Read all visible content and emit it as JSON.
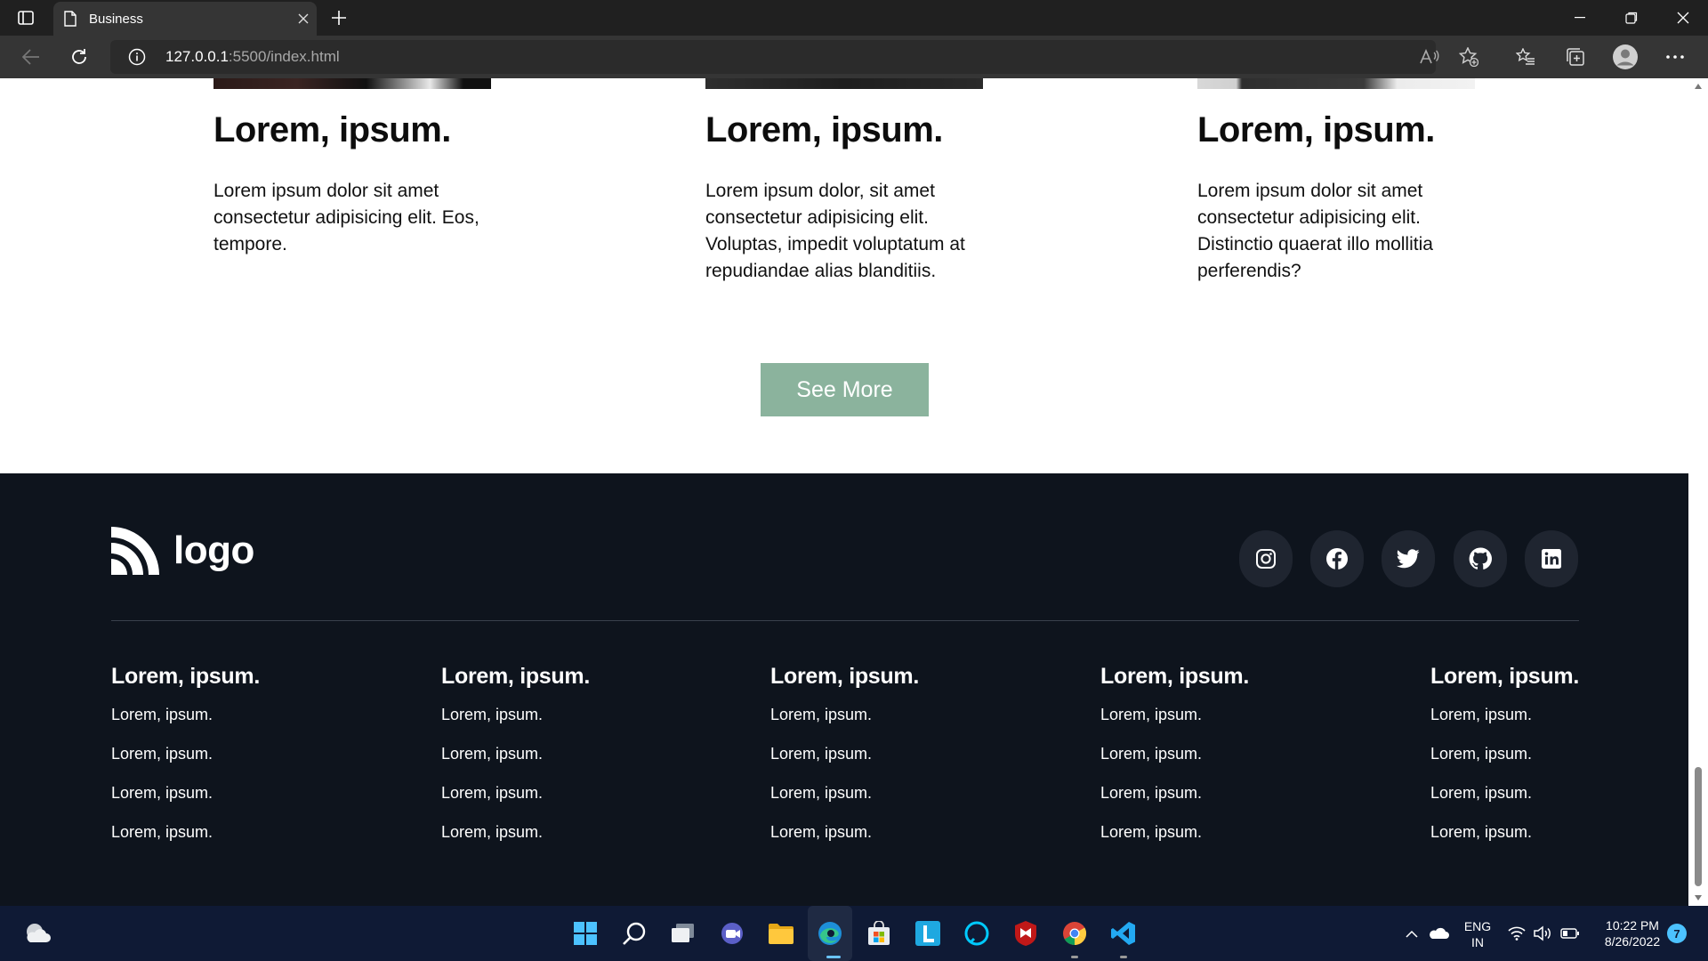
{
  "browser": {
    "tab_title": "Business",
    "url_host": "127.0.0.1",
    "url_rest": ":5500/index.html"
  },
  "cards": [
    {
      "title": "Lorem, ipsum.",
      "text": "Lorem ipsum dolor sit amet consectetur adipisicing elit. Eos, tempore."
    },
    {
      "title": "Lorem, ipsum.",
      "text": "Lorem ipsum dolor, sit amet consectetur adipisicing elit. Voluptas, impedit voluptatum at repudiandae alias blanditiis."
    },
    {
      "title": "Lorem, ipsum.",
      "text": "Lorem ipsum dolor sit amet consectetur adipisicing elit. Distinctio quaerat illo mollitia perferendis?"
    }
  ],
  "see_more_label": "See More",
  "footer": {
    "logo_text": "logo",
    "social_icons": [
      "instagram-icon",
      "facebook-icon",
      "twitter-icon",
      "github-icon",
      "linkedin-icon"
    ],
    "columns": [
      {
        "title": "Lorem, ipsum.",
        "links": [
          "Lorem, ipsum.",
          "Lorem, ipsum.",
          "Lorem, ipsum.",
          "Lorem, ipsum."
        ]
      },
      {
        "title": "Lorem, ipsum.",
        "links": [
          "Lorem, ipsum.",
          "Lorem, ipsum.",
          "Lorem, ipsum.",
          "Lorem, ipsum."
        ]
      },
      {
        "title": "Lorem, ipsum.",
        "links": [
          "Lorem, ipsum.",
          "Lorem, ipsum.",
          "Lorem, ipsum.",
          "Lorem, ipsum."
        ]
      },
      {
        "title": "Lorem, ipsum.",
        "links": [
          "Lorem, ipsum.",
          "Lorem, ipsum.",
          "Lorem, ipsum.",
          "Lorem, ipsum."
        ]
      },
      {
        "title": "Lorem, ipsum.",
        "links": [
          "Lorem, ipsum.",
          "Lorem, ipsum.",
          "Lorem, ipsum.",
          "Lorem, ipsum."
        ]
      }
    ]
  },
  "taskbar": {
    "lang_line1": "ENG",
    "lang_line2": "IN",
    "time": "10:22 PM",
    "date": "8/26/2022",
    "notification_count": "7"
  },
  "colors": {
    "accent_button": "#8bb39d",
    "footer_bg": "#0e141d"
  }
}
